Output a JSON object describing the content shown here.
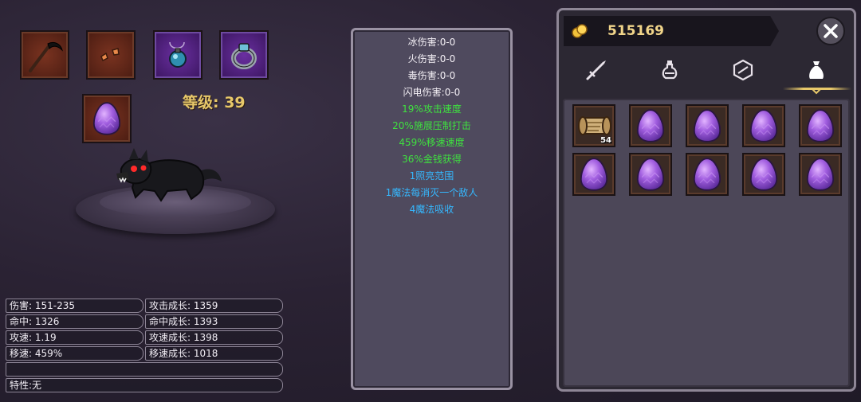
{
  "equipment": {
    "slots": [
      {
        "icon": "scythe-icon",
        "frame": "brown"
      },
      {
        "icon": "fang-fragments-icon",
        "frame": "brown"
      },
      {
        "icon": "potion-amulet-icon",
        "frame": "purple"
      },
      {
        "icon": "ring-icon",
        "frame": "purple"
      }
    ],
    "pet_slot": {
      "icon": "purple-egg-icon",
      "frame": "brown"
    },
    "level_label": "等级: 39"
  },
  "pet": {
    "name": "black-wolf",
    "icon": "black-wolf-icon"
  },
  "stats": {
    "rows": [
      [
        "伤害: 151-235",
        "攻击成长: 1359"
      ],
      [
        "命中: 1326",
        "命中成长: 1393"
      ],
      [
        "攻速: 1.19",
        "攻速成长: 1398"
      ],
      [
        "移速: 459%",
        "移速成长: 1018"
      ]
    ],
    "empty_row": "",
    "trait": "特性:无"
  },
  "attributes": {
    "lines": [
      {
        "text": "冰伤害:0-0",
        "color": "white"
      },
      {
        "text": "火伤害:0-0",
        "color": "white"
      },
      {
        "text": "毒伤害:0-0",
        "color": "white"
      },
      {
        "text": "闪电伤害:0-0",
        "color": "white"
      },
      {
        "text": "19%攻击速度",
        "color": "green"
      },
      {
        "text": "20%施展压制打击",
        "color": "green"
      },
      {
        "text": "459%移速速度",
        "color": "green"
      },
      {
        "text": "36%金钱获得",
        "color": "green"
      },
      {
        "text": "1照亮范围",
        "color": "blue"
      },
      {
        "text": "1魔法每消灭一个敌人",
        "color": "blue"
      },
      {
        "text": "4魔法吸收",
        "color": "blue"
      }
    ]
  },
  "inventory": {
    "gold": "515169",
    "gold_icon": "gold-coins-icon",
    "close_icon": "close-icon",
    "tabs": [
      {
        "icon": "sword-icon",
        "active": false
      },
      {
        "icon": "potion-icon",
        "active": false
      },
      {
        "icon": "gem-icon",
        "active": false
      },
      {
        "icon": "bag-icon",
        "active": true
      }
    ],
    "items": [
      {
        "icon": "scroll-icon",
        "count": "54"
      },
      {
        "icon": "purple-egg-icon",
        "count": ""
      },
      {
        "icon": "purple-egg-icon",
        "count": ""
      },
      {
        "icon": "purple-egg-icon",
        "count": ""
      },
      {
        "icon": "purple-egg-icon",
        "count": ""
      },
      {
        "icon": "purple-egg-icon",
        "count": ""
      },
      {
        "icon": "purple-egg-icon",
        "count": ""
      },
      {
        "icon": "purple-egg-icon",
        "count": ""
      },
      {
        "icon": "purple-egg-icon",
        "count": ""
      },
      {
        "icon": "purple-egg-icon",
        "count": ""
      }
    ]
  },
  "colors": {
    "accent_gold": "#e7c86a",
    "text_green": "#3fe23f",
    "text_blue": "#35b8ff"
  }
}
